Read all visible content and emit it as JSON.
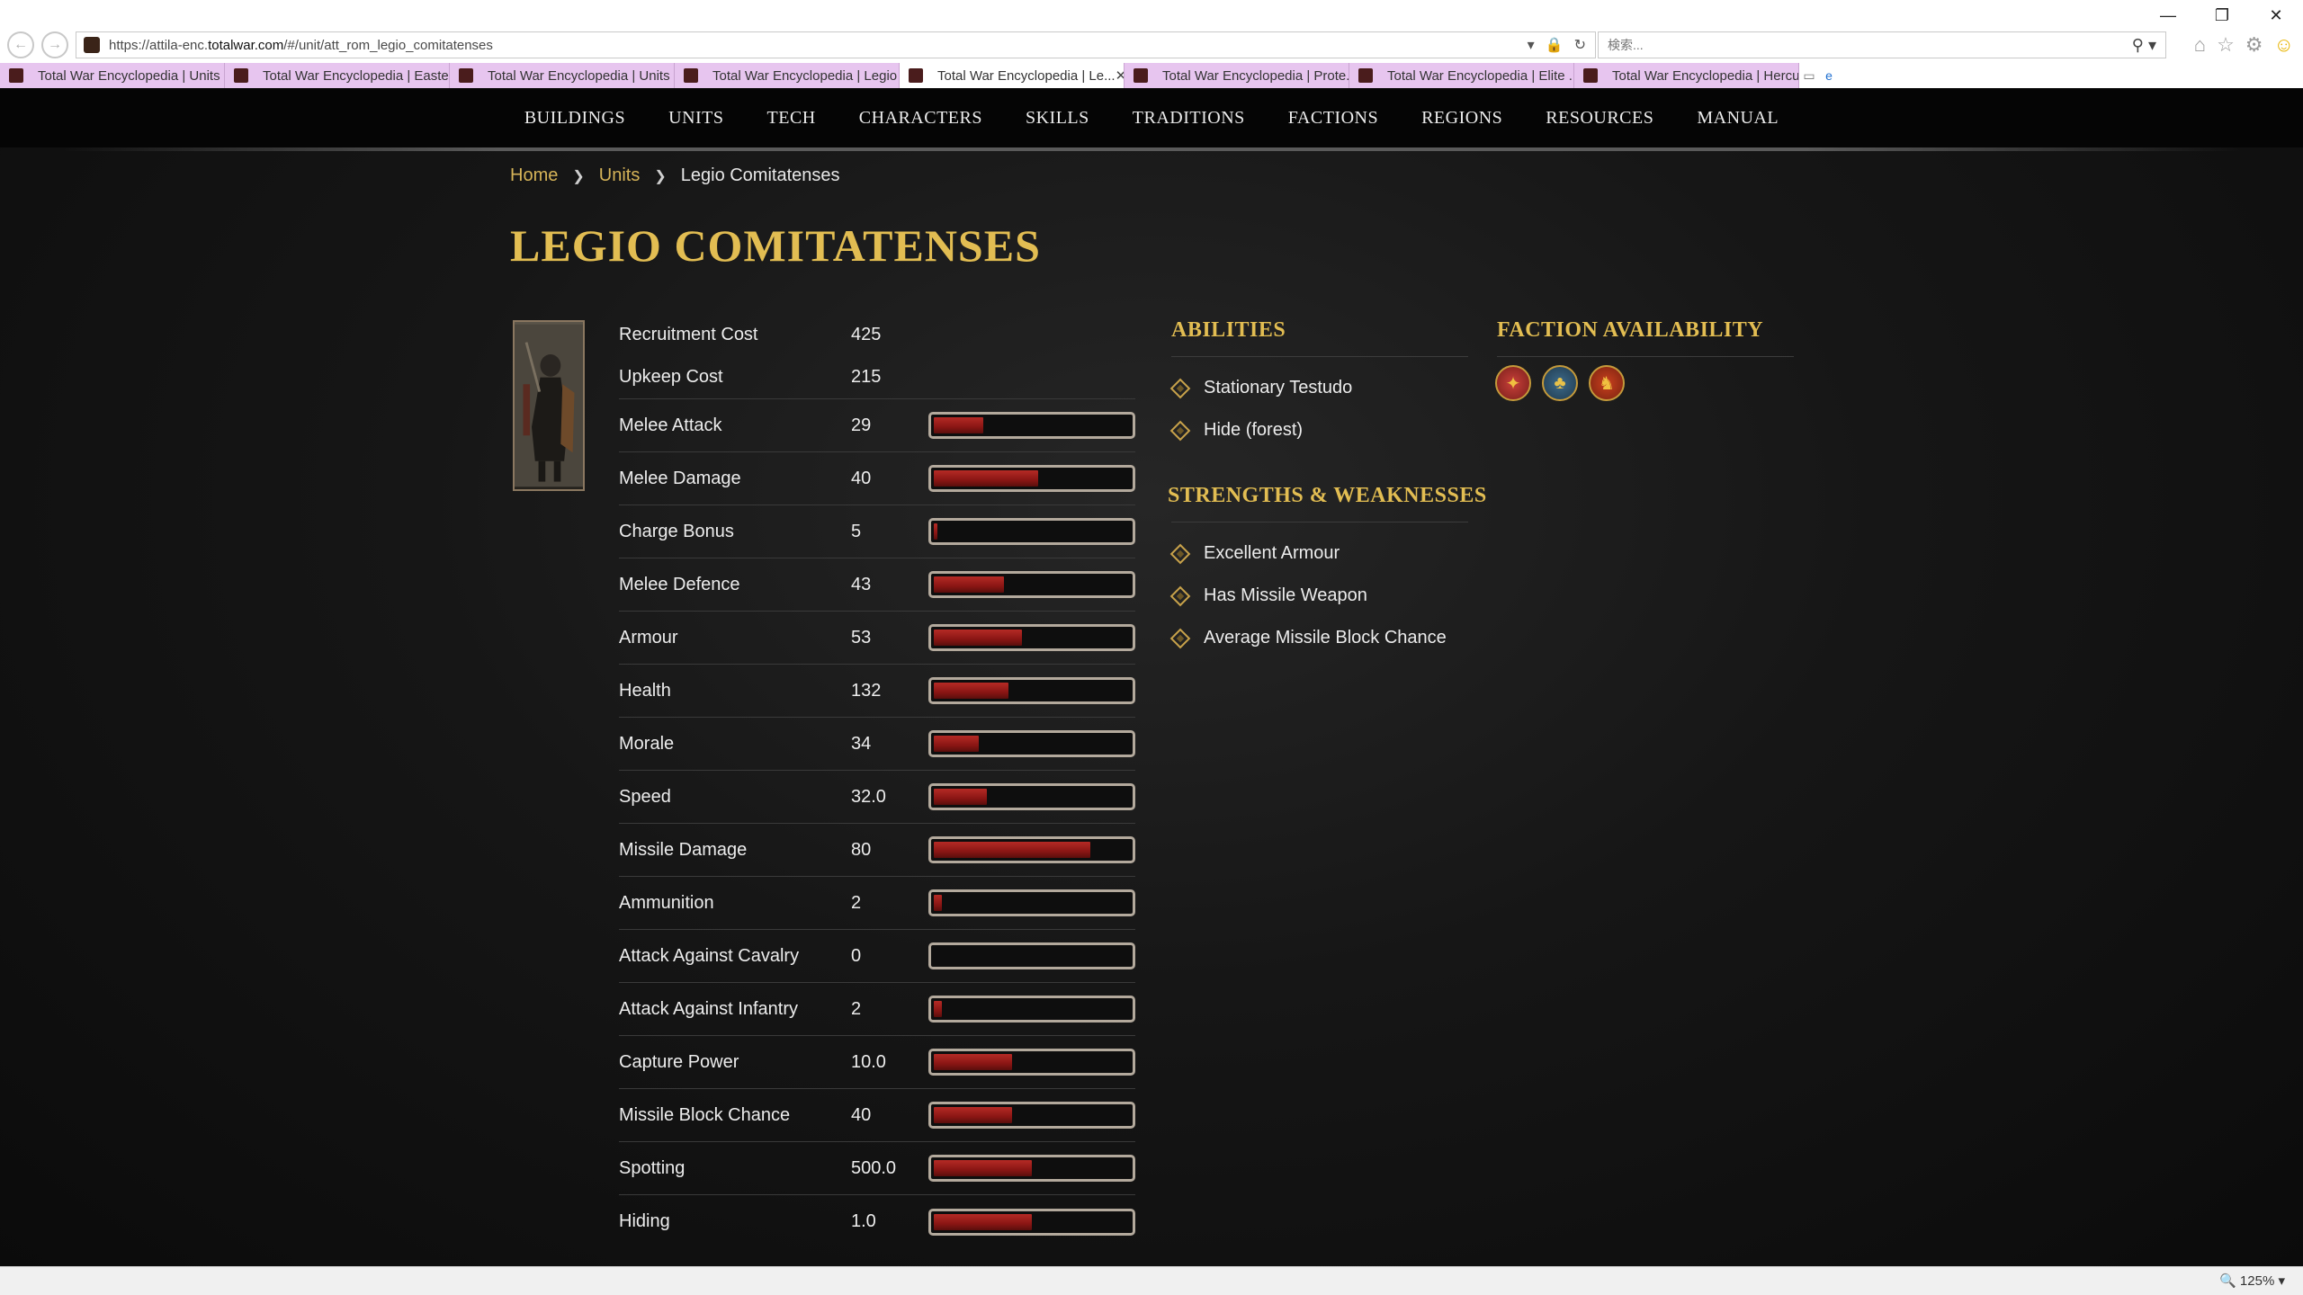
{
  "browser": {
    "url_prefix": "https://attila-enc.",
    "url_domain": "totalwar.com",
    "url_rest": "/#/unit/att_rom_legio_comitatenses",
    "search_placeholder": "検索...",
    "zoom": "125%",
    "tabs": [
      {
        "label": "Total War Encyclopedia | Units",
        "active": false
      },
      {
        "label": "Total War Encyclopedia | Easte...",
        "active": false
      },
      {
        "label": "Total War Encyclopedia | Units",
        "active": false
      },
      {
        "label": "Total War Encyclopedia | Legio",
        "active": false
      },
      {
        "label": "Total War Encyclopedia | Le...",
        "active": true
      },
      {
        "label": "Total War Encyclopedia | Prote...",
        "active": false
      },
      {
        "label": "Total War Encyclopedia | Elite ...",
        "active": false
      },
      {
        "label": "Total War Encyclopedia | Hercu...",
        "active": false
      }
    ]
  },
  "nav": [
    "BUILDINGS",
    "UNITS",
    "TECH",
    "CHARACTERS",
    "SKILLS",
    "TRADITIONS",
    "FACTIONS",
    "REGIONS",
    "RESOURCES",
    "MANUAL"
  ],
  "breadcrumb": {
    "home": "Home",
    "units": "Units",
    "current": "Legio Comitatenses"
  },
  "title": "LEGIO COMITATENSES",
  "costs": [
    {
      "label": "Recruitment Cost",
      "value": "425"
    },
    {
      "label": "Upkeep Cost",
      "value": "215"
    }
  ],
  "stats": [
    {
      "label": "Melee Attack",
      "value": "29",
      "fill": 0.25
    },
    {
      "label": "Melee Damage",
      "value": "40",
      "fill": 0.53
    },
    {
      "label": "Charge Bonus",
      "value": "5",
      "fill": 0.02
    },
    {
      "label": "Melee Defence",
      "value": "43",
      "fill": 0.36
    },
    {
      "label": "Armour",
      "value": "53",
      "fill": 0.45
    },
    {
      "label": "Health",
      "value": "132",
      "fill": 0.38
    },
    {
      "label": "Morale",
      "value": "34",
      "fill": 0.23
    },
    {
      "label": "Speed",
      "value": "32.0",
      "fill": 0.27
    },
    {
      "label": "Missile Damage",
      "value": "80",
      "fill": 0.8
    },
    {
      "label": "Ammunition",
      "value": "2",
      "fill": 0.04
    },
    {
      "label": "Attack Against Cavalry",
      "value": "0",
      "fill": 0
    },
    {
      "label": "Attack Against Infantry",
      "value": "2",
      "fill": 0.04
    },
    {
      "label": "Capture Power",
      "value": "10.0",
      "fill": 0.4
    },
    {
      "label": "Missile Block Chance",
      "value": "40",
      "fill": 0.4
    },
    {
      "label": "Spotting",
      "value": "500.0",
      "fill": 0.5
    },
    {
      "label": "Hiding",
      "value": "1.0",
      "fill": 0.5
    }
  ],
  "abilities": {
    "heading": "ABILITIES",
    "items": [
      "Stationary Testudo",
      "Hide (forest)"
    ]
  },
  "strengths": {
    "heading": "STRENGTHS & WEAKNESSES",
    "items": [
      "Excellent Armour",
      "Has Missile Weapon",
      "Average Missile Block Chance"
    ]
  },
  "factions": {
    "heading": "FACTION AVAILABILITY",
    "icons": [
      "eagle-emblem-icon",
      "tree-emblem-icon",
      "lion-emblem-icon"
    ]
  },
  "colors": {
    "accent_gold": "#e2bd52",
    "link_gold": "#d6b458",
    "bar_red": "#9c1d1a",
    "tab_pink": "#e7c5ef"
  }
}
